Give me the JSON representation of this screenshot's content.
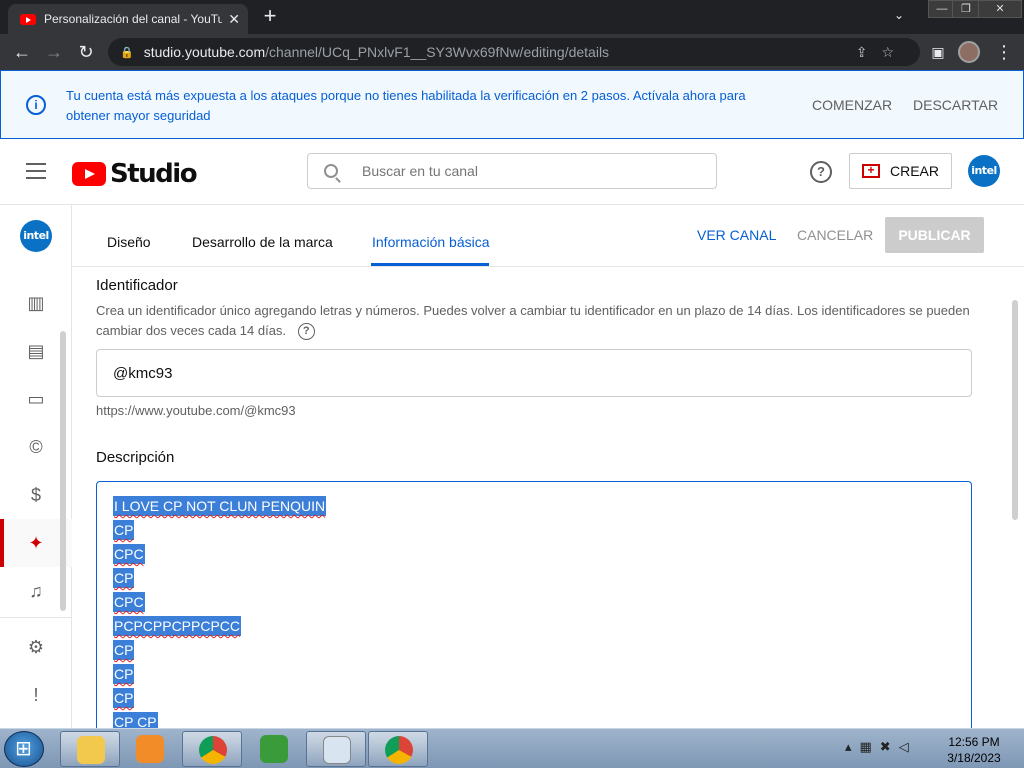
{
  "browser": {
    "tab_title": "Personalización del canal - YouTube Studio",
    "tab_close": "✕",
    "new_tab": "+",
    "url_host": "studio.youtube.com",
    "url_path": "/channel/UCq_PNxlvF1__SY3Wvx69fNw/editing/details"
  },
  "banner": {
    "message": "Tu cuenta está más expuesta a los ataques porque no tienes habilitada la verificación en 2 pasos. Actívala ahora para obtener mayor seguridad",
    "start_label": "COMENZAR",
    "dismiss_label": "DESCARTAR"
  },
  "header": {
    "logo_text": "Studio",
    "search_placeholder": "Buscar en tu canal",
    "create_label": "CREAR",
    "avatar_text": "intel"
  },
  "sidebar": {
    "channel_avatar_text": "intel",
    "icons": [
      "analytics-icon",
      "comments-icon",
      "subtitles-icon",
      "copyright-icon",
      "monetization-icon",
      "customization-icon",
      "audio-library-icon",
      "settings-icon",
      "feedback-icon"
    ]
  },
  "tabs": {
    "items": [
      {
        "label": "Diseño"
      },
      {
        "label": "Desarrollo de la marca"
      },
      {
        "label": "Información básica"
      }
    ],
    "view_channel": "VER CANAL",
    "cancel": "CANCELAR",
    "publish": "PUBLICAR"
  },
  "handle": {
    "title": "Identificador",
    "description": "Crea un identificador único agregando letras y números. Puedes volver a cambiar tu identificador en un plazo de 14 días. Los identificadores se pueden cambiar dos veces cada 14 días.",
    "value": "@kmc93",
    "url": "https://www.youtube.com/@kmc93"
  },
  "description": {
    "title": "Descripción",
    "lines": [
      "I LOVE CP NOT CLUN PENQUIN",
      "CP",
      "CPC",
      "CP",
      "CPC",
      "PCPCPPCPPCPCC",
      "CP",
      "CP",
      "CP",
      "CP CP"
    ]
  },
  "taskbar": {
    "time": "12:56 PM",
    "date": "3/18/2023"
  },
  "colors": {
    "accent": "#065fd4",
    "brand_red": "#ff0000",
    "selection": "#3b7fd9"
  }
}
